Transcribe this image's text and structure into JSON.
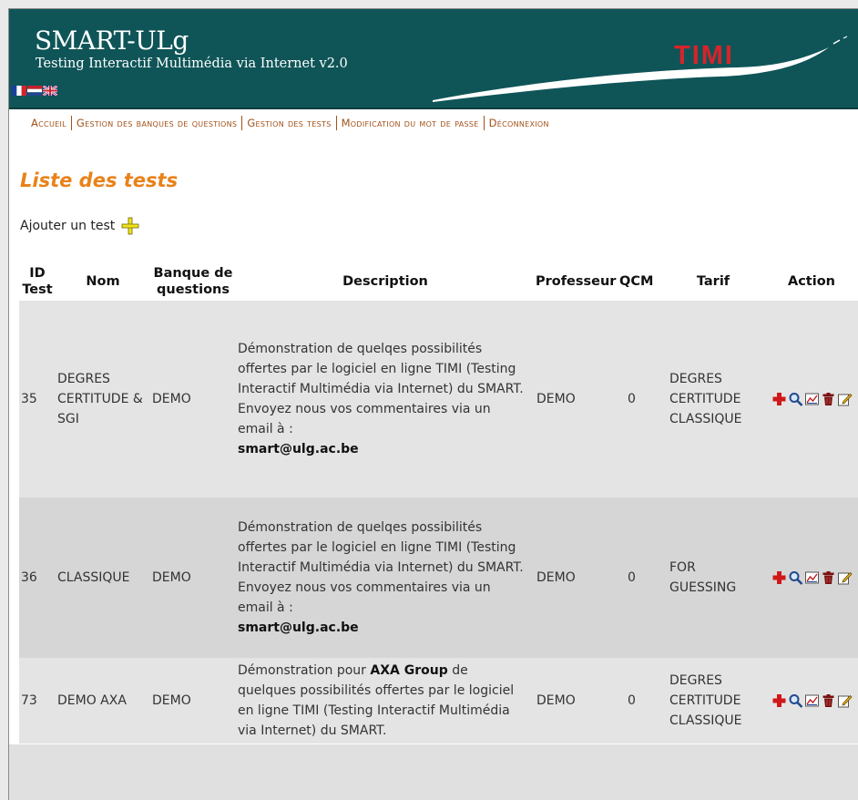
{
  "header": {
    "brand": "SMART-ULg",
    "subtitle": "Testing Interactif Multimédia via Internet v2.0",
    "logo_text": "TIMI",
    "flags": [
      "french-flag-icon",
      "dutch-flag-icon",
      "uk-flag-icon"
    ]
  },
  "nav": {
    "items": [
      "Accueil",
      "Gestion des banques de questions",
      "Gestion des tests",
      "Modification du mot de passe",
      "Déconnexion"
    ]
  },
  "page": {
    "title": "Liste des tests",
    "add_label": "Ajouter un test"
  },
  "table": {
    "headers": {
      "id_line1": "ID",
      "id_line2": "Test",
      "nom": "Nom",
      "banque_line1": "Banque de",
      "banque_line2": "questions",
      "description": "Description",
      "professeur": "Professeur",
      "qcm": "QCM",
      "tarif": "Tarif",
      "action": "Action"
    },
    "rows": [
      {
        "id": "35",
        "nom": "DEGRES CERTITUDE & SGI",
        "banque": "DEMO",
        "description": "Démonstration de quelqes possibilités offertes par le logiciel en ligne TIMI (Testing Interactif Multimédia via Internet) du SMART. Envoyez nous vos commentaires via un email à :",
        "email": "smart@ulg.ac.be",
        "professeur": "DEMO",
        "qcm": "0",
        "tarif": "DEGRES CERTITUDE CLASSIQUE"
      },
      {
        "id": "36",
        "nom": "CLASSIQUE",
        "banque": "DEMO",
        "description": "Démonstration de quelqes possibilités offertes par le logiciel en ligne TIMI (Testing Interactif Multimédia via Internet) du SMART. Envoyez nous vos commentaires via un email à :",
        "email": "smart@ulg.ac.be",
        "professeur": "DEMO",
        "qcm": "0",
        "tarif": "FOR GUESSING"
      },
      {
        "id": "73",
        "nom": "DEMO AXA",
        "banque": "DEMO",
        "description_pre": "Démonstration pour",
        "description_bold": "AXA Group",
        "description_post": "de quelques possibilités offertes par le logiciel en ligne TIMI (Testing Interactif Multimédia via Internet) du SMART.",
        "professeur": "DEMO",
        "qcm": "0",
        "tarif": "DEGRES CERTITUDE CLASSIQUE"
      }
    ],
    "action_icons": [
      "add-red-cross-icon",
      "magnifier-icon",
      "chart-icon",
      "trash-icon",
      "edit-icon"
    ]
  },
  "colors": {
    "header_bg": "#0f5558",
    "nav_link": "#a1521a",
    "title_orange": "#e8821a",
    "row_light": "#e4e4e4",
    "row_dark": "#d6d6d6"
  }
}
